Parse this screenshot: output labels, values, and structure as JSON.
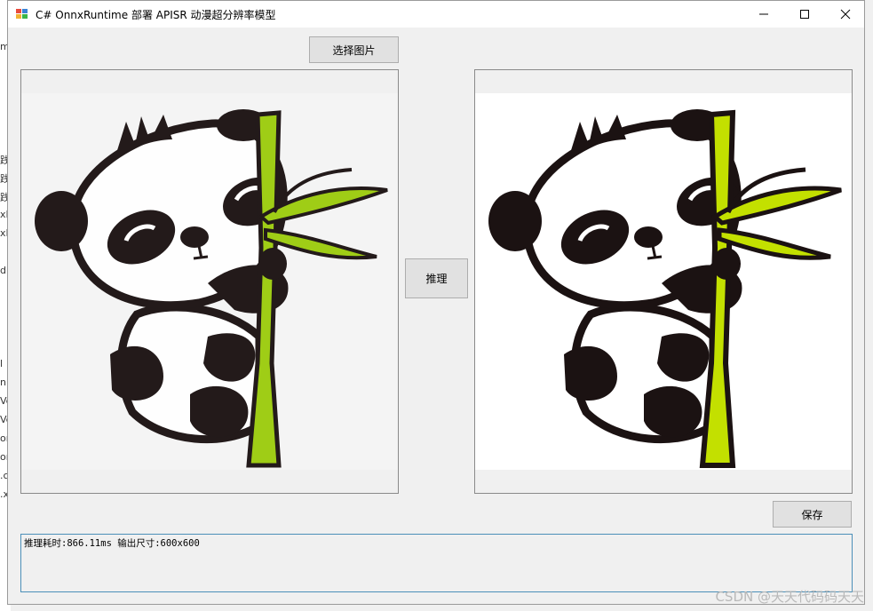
{
  "window": {
    "title": "C# OnnxRuntime 部署 APISR 动漫超分辨率模型"
  },
  "buttons": {
    "select_image": "选择图片",
    "infer": "推理",
    "save": "保存"
  },
  "output": {
    "text": "推理耗时:866.11ms  输出尺寸:600x600"
  },
  "background_app": {
    "fragments": [
      "m",
      "践",
      "践",
      "践",
      "xR",
      "xR",
      "d",
      "l",
      "nl",
      "Ve",
      "Ve",
      "on",
      "on",
      ".c",
      ".x"
    ]
  },
  "watermark": "CSDN @天天代码码天天",
  "colors": {
    "bamboo": "#9ccc0e",
    "bamboo_bright": "#c3e000",
    "panda_black": "#1b1212",
    "output_border": "#4b8fb8"
  }
}
